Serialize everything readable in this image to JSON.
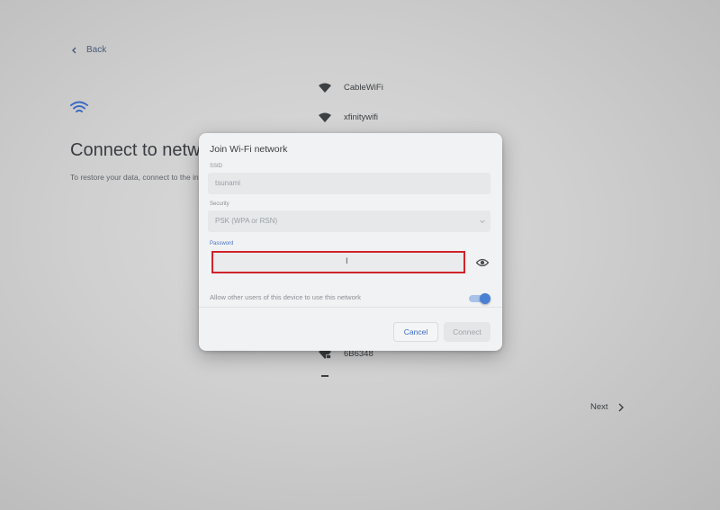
{
  "page": {
    "back_label": "Back",
    "title": "Connect to network",
    "subtitle": "To restore your data, connect to the internet",
    "next_label": "Next"
  },
  "networks": [
    {
      "name": "CableWiFi",
      "secured": false
    },
    {
      "name": "xfinitywifi",
      "secured": false
    },
    {
      "name": "6B6348",
      "secured": true
    },
    {
      "name": "",
      "secured": false
    }
  ],
  "dialog": {
    "title": "Join Wi-Fi network",
    "ssid_label": "SSID",
    "ssid_value": "tsunami",
    "security_label": "Security",
    "security_value": "PSK (WPA or RSN)",
    "password_label": "Password",
    "password_value": "",
    "share_label": "Allow other users of this device to use this network",
    "share_enabled": true,
    "cancel_label": "Cancel",
    "connect_label": "Connect"
  },
  "colors": {
    "accent": "#3b6bc3",
    "highlight_border": "#d0232c",
    "toggle_on": "#4a80d4"
  },
  "icons": {
    "back": "arrow-left-icon",
    "wifi": "wifi-icon",
    "lock": "lock-icon",
    "eye": "eye-icon",
    "next": "chevron-right-icon",
    "cursor": "text-cursor-icon"
  }
}
